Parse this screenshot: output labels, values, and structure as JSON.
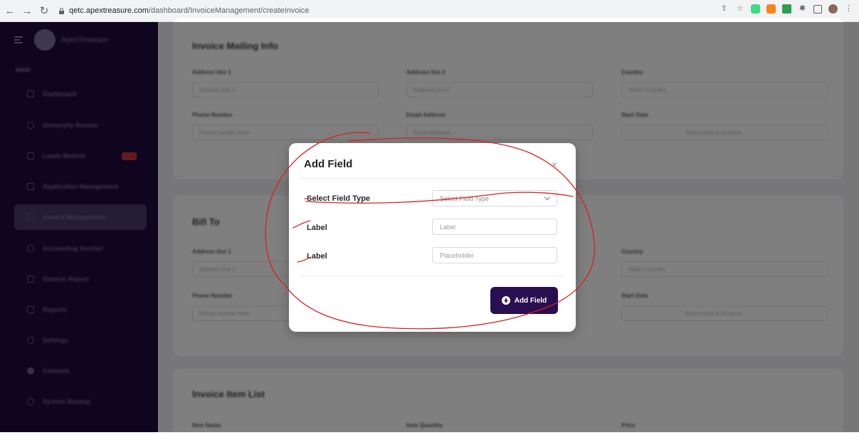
{
  "browser": {
    "url_host": "qetc.apextreasure.com",
    "url_path": "/dashboard/InvoiceManagement/createInvoice"
  },
  "sidebar": {
    "brand": "ApexTreasure",
    "section": "MAIN",
    "items": [
      {
        "label": "Dashboard"
      },
      {
        "label": "University Review"
      },
      {
        "label": "Leads Module",
        "badge": "12"
      },
      {
        "label": "Application Management"
      },
      {
        "label": "Invoice Management"
      },
      {
        "label": "Accounting Section"
      },
      {
        "label": "Generic Report"
      },
      {
        "label": "Reports"
      },
      {
        "label": "Settings"
      },
      {
        "label": "Contacts"
      },
      {
        "label": "System Backup"
      }
    ]
  },
  "main": {
    "card1": {
      "title": "Invoice Mailing Info",
      "labels": [
        "Address line 1",
        "Address line 2",
        "Country",
        "Phone Number",
        "Email Address",
        "Start Date"
      ],
      "placeholders": [
        "Address line 1",
        "Address line 2",
        "Select Country",
        "Phone number here",
        "Email Address",
        "Select date & Duration"
      ]
    },
    "card2": {
      "title": "Bill To",
      "labels": [
        "Address line 1",
        "Country",
        "Phone Number",
        "Start Date"
      ],
      "placeholders": [
        "Address line 1",
        "Select Country",
        "Phone number here",
        "Select date & Duration"
      ]
    },
    "card3": {
      "title": "Invoice Item List",
      "labels": [
        "Item Name",
        "Item Quantity",
        "Price"
      ]
    }
  },
  "modal": {
    "title": "Add Field",
    "close_symbol": "×",
    "select_label": "Select Field Type",
    "select_value": "Select Field Type",
    "label_label": "Label",
    "label_placeholder": "Label",
    "placeholder_label": "Label",
    "placeholder_placeholder": "Placeholder",
    "add_button": "Add Field"
  },
  "colors": {
    "sidebar_bg": "#1f0a3c",
    "primary_button": "#2a0e52",
    "annotation": "#d8221f"
  }
}
